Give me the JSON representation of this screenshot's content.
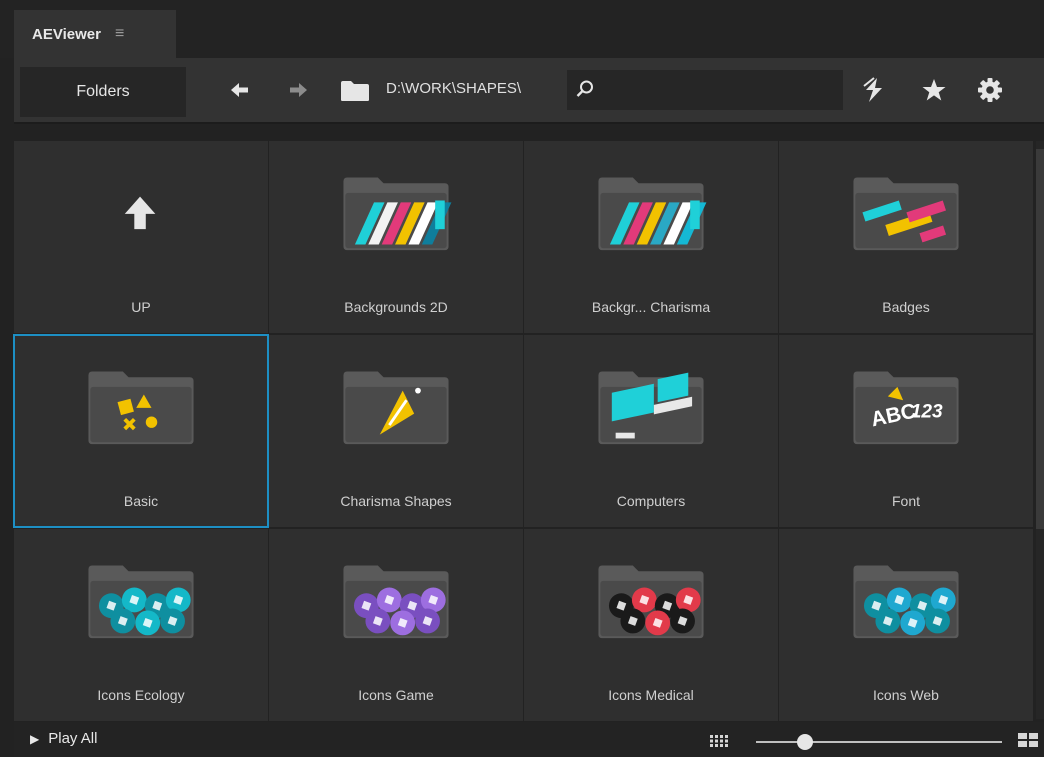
{
  "app": {
    "tab_title": "AEViewer",
    "tab_menu_glyph": "≡"
  },
  "toolbar": {
    "folders_label": "Folders",
    "back_icon": "arrow-left-icon",
    "forward_icon": "arrow-right-icon",
    "path": "D:\\WORK\\SHAPES\\",
    "search": {
      "value": "",
      "placeholder": ""
    },
    "icons": [
      "sync-icon",
      "star-icon",
      "gear-icon"
    ]
  },
  "grid": {
    "selected_index": 4,
    "items": [
      {
        "label": "UP",
        "kind": "up"
      },
      {
        "label": "Backgrounds 2D",
        "kind": "stripes",
        "colors": [
          "#1fd0d8",
          "#f2f2f2",
          "#e23a7a",
          "#f2c200",
          "#ffffff",
          "#0f7e9c"
        ]
      },
      {
        "label": "Backgr... Charisma",
        "kind": "stripes",
        "colors": [
          "#1fd0d8",
          "#e23a7a",
          "#f2c200",
          "#2aa8c4",
          "#ffffff",
          "#15b8d4"
        ]
      },
      {
        "label": "Badges",
        "kind": "badges",
        "colors": [
          "#1fd0d8",
          "#f2c200",
          "#e23a7a"
        ]
      },
      {
        "label": "Basic",
        "kind": "basic",
        "colors": [
          "#f2c200"
        ]
      },
      {
        "label": "Charisma Shapes",
        "kind": "charisma",
        "colors": [
          "#f2c200"
        ]
      },
      {
        "label": "Computers",
        "kind": "computers",
        "colors": [
          "#1fd0d8",
          "#e8e8e8"
        ]
      },
      {
        "label": "Font",
        "kind": "font",
        "colors": [
          "#f2c200",
          "#ffffff"
        ]
      },
      {
        "label": "Icons Ecology",
        "kind": "circles",
        "colors": [
          "#0f8fa0",
          "#14b8c8"
        ]
      },
      {
        "label": "Icons Game",
        "kind": "circles",
        "colors": [
          "#7a4fc0",
          "#9d6ee0"
        ]
      },
      {
        "label": "Icons Medical",
        "kind": "circles",
        "colors": [
          "#1a1a1a",
          "#e23a4a"
        ]
      },
      {
        "label": "Icons Web",
        "kind": "circles",
        "colors": [
          "#0f8fa0",
          "#1fa8d0"
        ]
      }
    ]
  },
  "bottom": {
    "play_all": "Play All",
    "zoom_level": 0.2
  },
  "colors": {
    "accent": "#1d8fc4",
    "panel": "#2f2f2f",
    "background": "#222222"
  }
}
